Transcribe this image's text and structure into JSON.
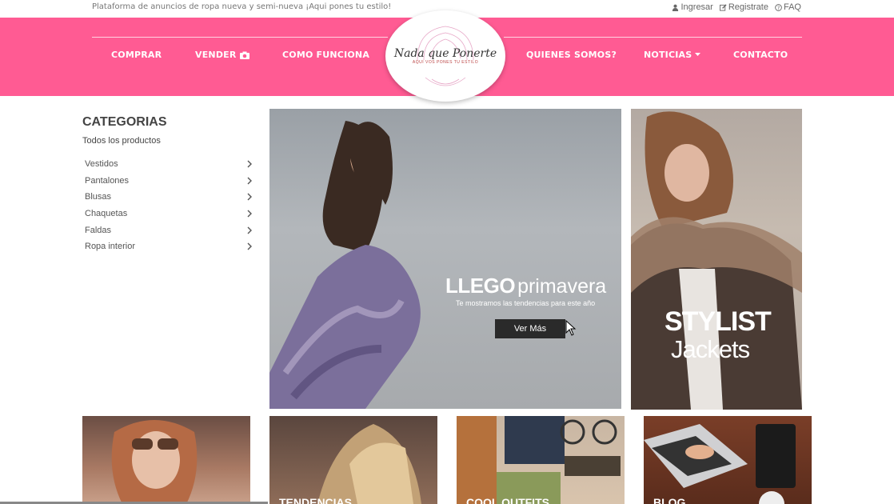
{
  "topbar": {
    "tagline": "Plataforma de anuncios de ropa nueva y semi-nueva ¡Aqui pones tu estilo!",
    "links": [
      {
        "label": "Ingresar",
        "icon": "user-icon"
      },
      {
        "label": "Registrate",
        "icon": "edit-icon"
      },
      {
        "label": "FAQ",
        "icon": "help-icon"
      }
    ]
  },
  "nav": {
    "left": [
      "COMPRAR",
      "VENDER",
      "COMO FUNCIONA"
    ],
    "right": [
      "QUIENES SOMOS?",
      "NOTICIAS",
      "CONTACTO"
    ],
    "vender_icon": "camera-icon",
    "noticias_icon": "caret-down-icon",
    "brand_color": "#ff5b93"
  },
  "logo": {
    "title": "Nada que Ponerte",
    "subtitle": "AQUI VOS PONES TU ESTILO"
  },
  "categories": {
    "title": "CATEGORIAS",
    "all": "Todos los productos",
    "items": [
      "Vestidos",
      "Pantalones",
      "Blusas",
      "Chaquetas",
      "Faldas",
      "Ropa interior"
    ]
  },
  "hero": {
    "headline_bold": "LLEGO",
    "headline_light": "primavera",
    "subtitle": "Te mostramos las tendencias para este año",
    "button": "Ver Más"
  },
  "side_banner": {
    "line1": "STYLIST",
    "line2": "Jackets"
  },
  "thumbs": [
    "",
    "TENDENCIAS",
    "COOL OUTFITS",
    "BLOG"
  ]
}
